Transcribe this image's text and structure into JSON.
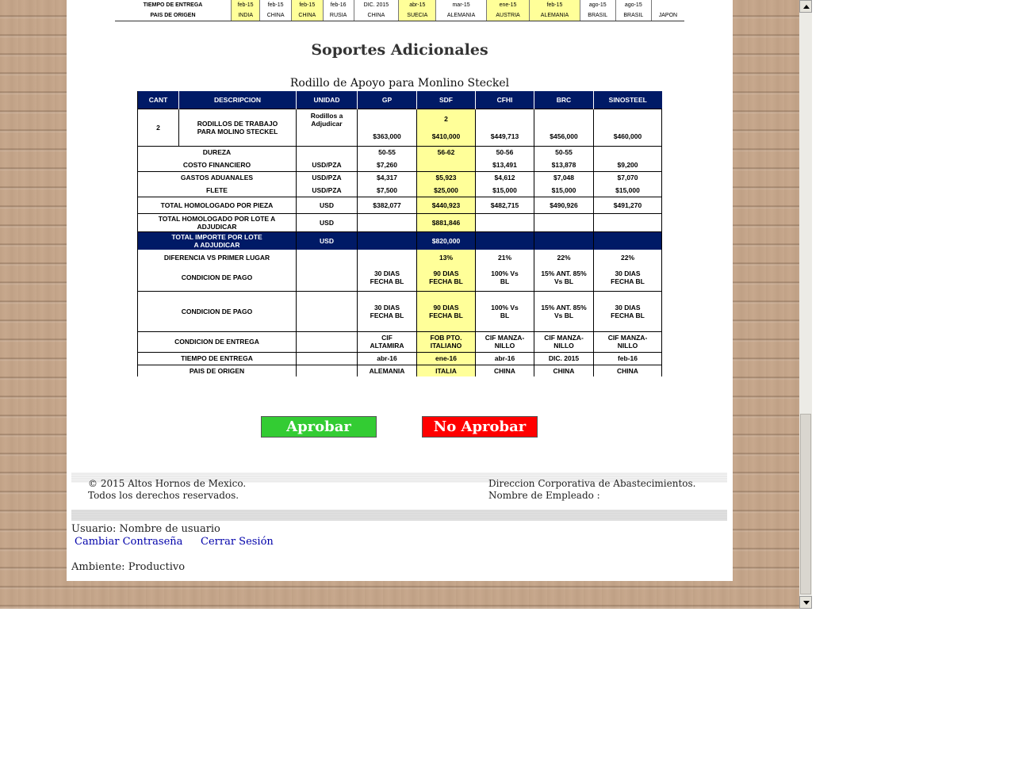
{
  "top_strip": {
    "rows": [
      {
        "label": "TIEMPO DE ENTREGA",
        "cells": [
          "feb-15",
          "feb-15",
          "feb-15",
          "feb-16",
          "DIC. 2015",
          "abr-15",
          "mar-15",
          "ene-15",
          "feb-15",
          "ago-15",
          "ago-15",
          ""
        ]
      },
      {
        "label": "PAIS DE ORIGEN",
        "cells": [
          "INDIA",
          "CHINA",
          "CHINA",
          "RUSIA",
          "CHINA",
          "SUECIA",
          "ALEMANIA",
          "AUSTRIA",
          "ALEMANIA",
          "BRASIL",
          "BRASIL",
          "JAPON"
        ]
      }
    ],
    "highlight_color": "#ffff99"
  },
  "section_title": "Soportes Adicionales",
  "table_title": "Rodillo de Apoyo para Monlino Steckel",
  "table": {
    "headers": [
      "CANT",
      "DESCRIPCION",
      "UNIDAD",
      "GP",
      "SDF",
      "CFHI",
      "BRC",
      "SINOSTEEL"
    ],
    "header_color": "#001a66",
    "selected_color": "#ffff99",
    "item": {
      "cant": "2",
      "descripcion": "RODILLOS DE TRABAJO PARA MOLINO STECKEL",
      "unidad": "Rodillos a Adjudicar",
      "sdf_qty": "2",
      "prices": [
        "$363,000",
        "$410,000",
        "$449,713",
        "$456,000",
        "$460,000"
      ]
    },
    "rows": [
      {
        "label": "DUREZA",
        "unit": "",
        "values": [
          "50-55",
          "56-62",
          "50-56",
          "50-55",
          ""
        ]
      },
      {
        "label": "COSTO FINANCIERO",
        "unit": "USD/PZA",
        "values": [
          "$7,260",
          "",
          "$13,491",
          "$13,878",
          "$9,200"
        ]
      },
      {
        "label": "GASTOS ADUANALES",
        "unit": "USD/PZA",
        "values": [
          "$4,317",
          "$5,923",
          "$4,612",
          "$7,048",
          "$7,070"
        ]
      },
      {
        "label": "FLETE",
        "unit": "USD/PZA",
        "values": [
          "$7,500",
          "$25,000",
          "$15,000",
          "$15,000",
          "$15,000"
        ]
      },
      {
        "label": "TOTAL HOMOLOGADO POR PIEZA",
        "unit": "USD",
        "values": [
          "$382,077",
          "$440,923",
          "$482,715",
          "$490,926",
          "$491,270"
        ]
      },
      {
        "label": "TOTAL HOMOLOGADO POR LOTE A ADJUDICAR",
        "unit": "USD",
        "values": [
          "",
          "$881,846",
          "",
          "",
          ""
        ]
      },
      {
        "label": "TOTAL IMPORTE POR LOTE A ADJUDICAR",
        "unit": "USD",
        "values": [
          "",
          "$820,000",
          "",
          "",
          ""
        ]
      },
      {
        "label": "DIFERENCIA VS PRIMER LUGAR",
        "unit": "",
        "values": [
          "",
          "13%",
          "21%",
          "22%",
          "22%"
        ]
      },
      {
        "label": "CONDICION DE PAGO",
        "unit": "",
        "values": [
          "30 DIAS FECHA BL",
          "90 DIAS FECHA BL",
          "100% Vs BL",
          "15% ANT. 85% Vs BL",
          "30 DIAS FECHA BL"
        ]
      },
      {
        "label": "CONDICION DE PAGO",
        "unit": "",
        "values": [
          "30 DIAS FECHA BL",
          "90 DIAS FECHA BL",
          "100% Vs BL",
          "15% ANT. 85% Vs BL",
          "30 DIAS FECHA BL"
        ]
      },
      {
        "label": "CONDICION DE ENTREGA",
        "unit": "",
        "values": [
          "CIF ALTAMIRA",
          "FOB PTO. ITALIANO",
          "CIF MANZA- NILLO",
          "CIF MANZA- NILLO",
          "CIF MANZA- NILLO"
        ]
      },
      {
        "label": "TIEMPO DE ENTREGA",
        "unit": "",
        "values": [
          "abr-16",
          "ene-16",
          "abr-16",
          "DIC. 2015",
          "feb-16"
        ]
      },
      {
        "label": "PAIS DE ORIGEN",
        "unit": "",
        "values": [
          "ALEMANIA",
          "ITALIA",
          "CHINA",
          "CHINA",
          "CHINA"
        ]
      }
    ]
  },
  "buttons": {
    "approve": {
      "label": "Aprobar",
      "color": "#33cc33"
    },
    "reject": {
      "label": "No Aprobar",
      "color": "#ff0000"
    }
  },
  "footer": {
    "copyright": "© 2015 Altos Hornos de Mexico.",
    "rights": "Todos los derechos reservados.",
    "department": "Direccion Corporativa de Abastecimientos.",
    "employee_label": "Nombre de Empleado :"
  },
  "session": {
    "user_label": "Usuario:",
    "user_name": "Nombre de usuario",
    "change_password": "Cambiar Contraseña",
    "logout": "Cerrar Sesión",
    "environment_label": "Ambiente:",
    "environment_value": "Productivo"
  }
}
